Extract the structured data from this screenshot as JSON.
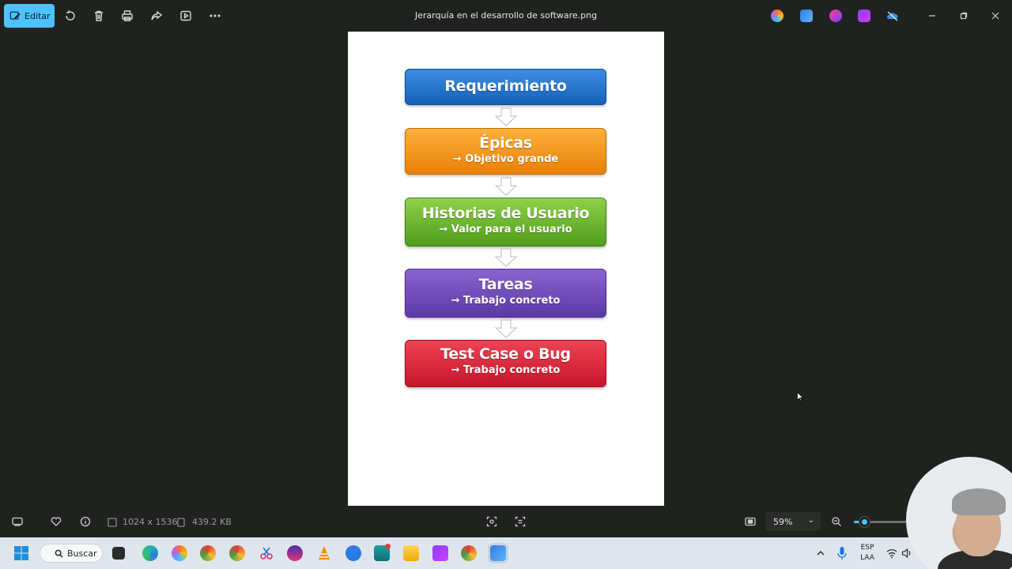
{
  "toolbar": {
    "edit_label": "Editar",
    "file_title": "Jerarquía en el desarrollo de software.png"
  },
  "diagram": {
    "steps": [
      {
        "title": "Requerimiento",
        "subtitle": ""
      },
      {
        "title": "Épicas",
        "subtitle": "→ Objetivo grande"
      },
      {
        "title": "Historias de Usuario",
        "subtitle": "→ Valor para el usuario"
      },
      {
        "title": "Tareas",
        "subtitle": "→ Trabajo concreto"
      },
      {
        "title": "Test Case o Bug",
        "subtitle": "→ Trabajo concreto"
      }
    ],
    "colors": [
      "#1f6fc6",
      "#f29415",
      "#62b52a",
      "#6c48b8",
      "#d92337"
    ]
  },
  "status": {
    "dimensions": "1024 x 1536",
    "file_size": "439.2 KB",
    "zoom": "59%"
  },
  "taskbar": {
    "search_label": "Buscar",
    "lang_line1": "ESP",
    "lang_line2": "LAA"
  },
  "colors": {
    "accent": "#4cc2ff",
    "background": "#1f221f"
  }
}
